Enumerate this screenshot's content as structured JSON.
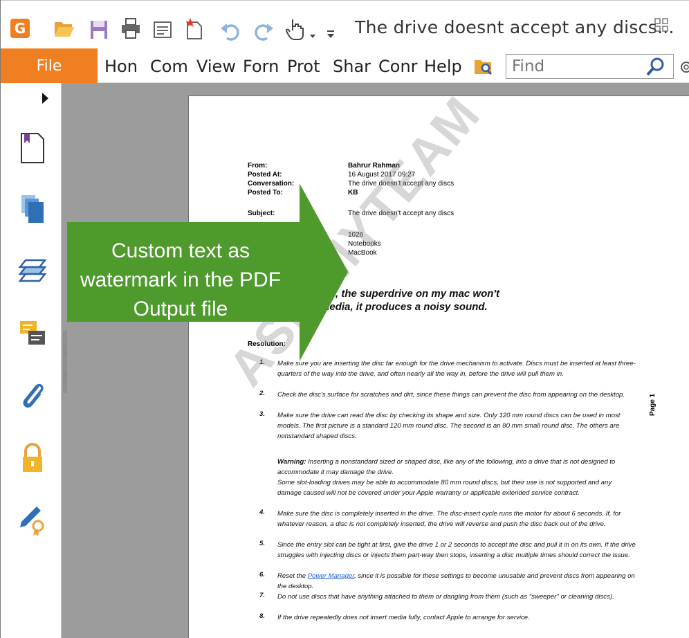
{
  "window": {
    "title": "The drive doesnt accept any discs...",
    "logo_letter": "G"
  },
  "ribbon": {
    "file": "File",
    "tabs": [
      "Hon",
      "Com",
      "View",
      "Forn",
      "Prot",
      "Shar",
      "Conr",
      "Help"
    ],
    "find_placeholder": "Find"
  },
  "document": {
    "meta": [
      {
        "label": "From:",
        "value": "Bahrur Rahman"
      },
      {
        "label": "Posted At:",
        "value": "16 August 2017 09:27"
      },
      {
        "label": "Conversation:",
        "value": "The drive doesn't accept any discs"
      },
      {
        "label": "Posted To:",
        "value": "KB"
      }
    ],
    "subject_label": "Subject:",
    "subject_value": "The drive doesn't accept any discs",
    "extra": [
      "1026",
      "Notebooks",
      "MacBook"
    ],
    "question_line1": "r. Since yesterday, the superdrive on my mac won't",
    "question_line2": "en playing the media, it produces a noisy sound.",
    "resolution_label": "Resolution:",
    "steps": [
      {
        "num": "1.",
        "text": "Make sure you are inserting the disc far enough for the drive mechanism to activate. Discs must be inserted at least three-quarters of the way into the drive, and often nearly all the way in, before the drive will pull them in."
      },
      {
        "num": "2.",
        "text": "Check the disc's surface for scratches and dirt, since these things can prevent the disc from appearing on the desktop."
      },
      {
        "num": "3.",
        "text": "Make sure the drive can read the disc by checking its shape and size. Only 120 mm round discs can be used in most models. The first picture is a standard 120 mm round disc. The second is an 80 mm small round disc. The others are nonstandard shaped discs."
      }
    ],
    "warning_bold": "Warning:",
    "warning_text": " Inserting a nonstandard sized or shaped disc, like any of the following, into a drive that is not designed to accommodate it may damage the drive.",
    "warning_text2": "Some slot-loading drives may be able to accommodate 80 mm round discs, but their use is not supported and any damage caused will not be covered under your Apple warranty or applicable extended service contract.",
    "steps2": [
      {
        "num": "4.",
        "text": "Make sure the disc is completely inserted in the drive. The disc-insert cycle runs the motor for about 6 seconds. If, for whatever reason, a disc is not completely inserted, the drive will reverse and push the disc back out of the drive."
      },
      {
        "num": "5.",
        "text": "Since the entry slot can be tight at first, give the drive 1 or 2 seconds to accept the disc and pull it in on its own. If the drive struggles with injecting discs or injects them part-way then stops, inserting a disc multiple times should correct the issue."
      }
    ],
    "step6_num": "6.",
    "step6_pre": "Reset the ",
    "step6_link": "Power Manager",
    "step6_post": ", since it is possible for these settings to become unusable and prevent discs from appearing on the desktop.",
    "steps3": [
      {
        "num": "7.",
        "text": "Do not use discs that have anything attached to them or dangling from them (such as \"sweeper\" or cleaning discs)."
      },
      {
        "num": "8.",
        "text": "If the drive repeatedly does not insert media fully, contact Apple to arrange for service."
      }
    ],
    "page_label": "Page 1",
    "watermark": "ASK MYTEAM"
  },
  "callout": {
    "text": "Custom text as watermark in the PDF Output file",
    "color": "#4f9a2d"
  },
  "colors": {
    "accent": "#f07f22",
    "doc_bg": "#9c9c9c"
  }
}
